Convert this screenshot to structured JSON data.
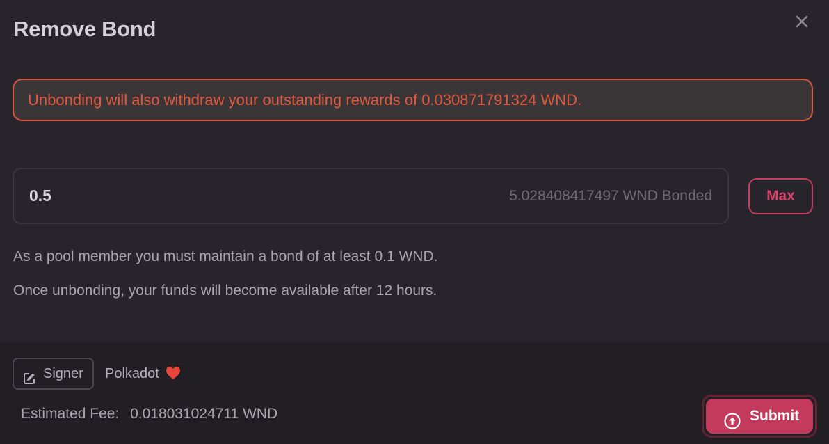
{
  "modal": {
    "title": "Remove Bond",
    "close_icon": "close-icon"
  },
  "warning": {
    "text": "Unbonding will also withdraw your outstanding rewards of 0.030871791324 WND.",
    "color": "#e05a3f"
  },
  "unbond_input": {
    "value": "0.5",
    "bonded_text": "5.028408417497 WND Bonded"
  },
  "max_button": {
    "label": "Max"
  },
  "notes": {
    "min_bond": "As a pool member you must maintain a bond of at least 0.1 WND.",
    "unbond_time": "Once unbonding, your funds will become available after 12 hours."
  },
  "footer": {
    "signer_label": "Signer",
    "signer_icon": "edit-icon",
    "account_name": "Polkadot",
    "account_icon": "heart-icon",
    "fee_label": "Estimated Fee:",
    "fee_value": "0.018031024711 WND",
    "submit_label": "Submit",
    "submit_icon": "arrow-up-circle-icon"
  },
  "colors": {
    "accent": "#c43a5c",
    "background": "#27242b",
    "footer_background": "#211e24"
  }
}
